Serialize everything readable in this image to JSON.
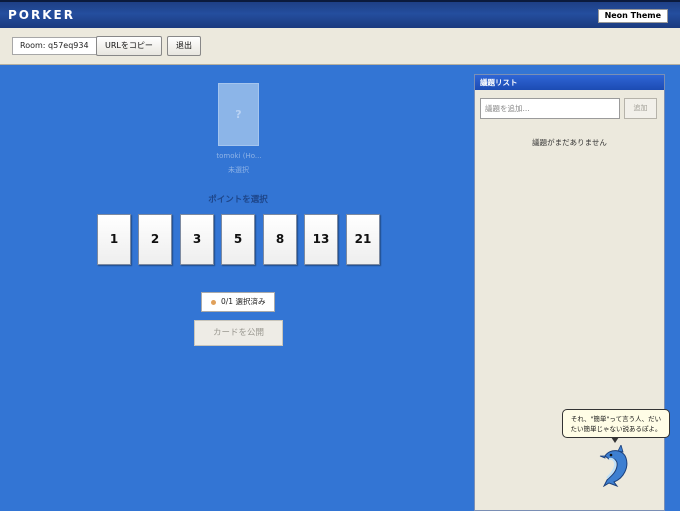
{
  "app": {
    "logo": "PORKER",
    "theme_button": "Neon Theme"
  },
  "toolbar": {
    "room": "Room: q57eq934",
    "copy_url": "URLをコピー",
    "leave": "退出"
  },
  "player": {
    "card_mark": "?",
    "name": "tomoki (Ho...",
    "status": "未選択"
  },
  "voting": {
    "title": "ポイントを選択",
    "cards": [
      "1",
      "2",
      "3",
      "5",
      "8",
      "13",
      "21"
    ],
    "status": "0/1 選択済み",
    "reveal_button": "カードを公開"
  },
  "topics": {
    "header": "議題リスト",
    "input_placeholder": "議題を追加...",
    "add_button": "追加",
    "empty_message": "議題がまだありません"
  },
  "mascot": {
    "speech_line1": "それ、\"簡単\"って言う人、だい",
    "speech_line2": "たい簡単じゃない説あるぽよ。"
  },
  "colors": {
    "background": "#3375d4",
    "topbar": "#244e9e",
    "toolbar": "#ece9dd",
    "panel_header": "#2f66d6",
    "status_dot": "#e0a05a"
  }
}
